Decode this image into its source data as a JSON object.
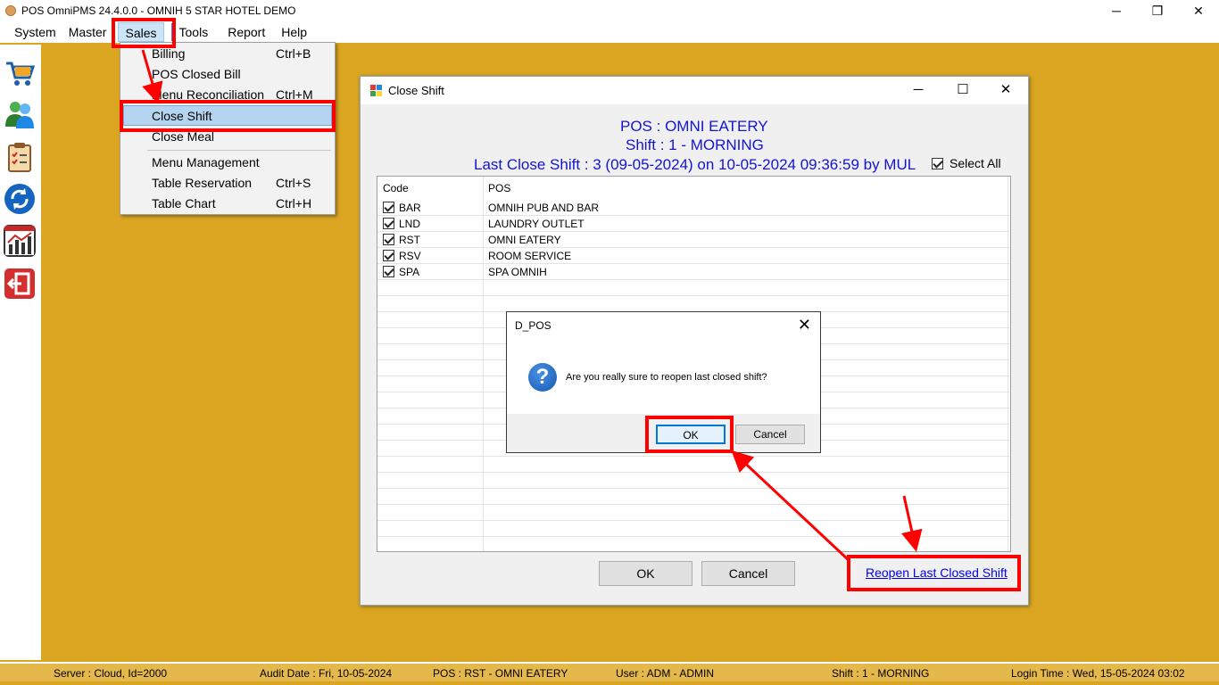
{
  "app": {
    "title": "POS OmniPMS 24.4.0.0 - OMNIH 5 STAR HOTEL DEMO",
    "window_buttons": [
      "─",
      "❐",
      "✕"
    ]
  },
  "menubar": {
    "items": [
      "System",
      "Master",
      "Sales",
      "Tools",
      "Report",
      "Help"
    ]
  },
  "toolbar_icons": [
    "cart-icon",
    "users-icon",
    "clipboard-icon",
    "refresh-icon",
    "chart-icon",
    "exit-icon"
  ],
  "sales_menu": {
    "items": [
      {
        "label": "Billing",
        "shortcut": "Ctrl+B"
      },
      {
        "label": "POS Closed Bill",
        "shortcut": ""
      },
      {
        "label": "Menu Reconciliation",
        "shortcut": "Ctrl+M"
      },
      {
        "label": "Close Shift",
        "shortcut": ""
      },
      {
        "label": "Close Meal",
        "shortcut": ""
      },
      {
        "label": "Menu Management",
        "shortcut": ""
      },
      {
        "label": "Table Reservation",
        "shortcut": "Ctrl+S"
      },
      {
        "label": "Table Chart",
        "shortcut": "Ctrl+H"
      }
    ]
  },
  "close_shift": {
    "title": "Close Shift",
    "pos_line": "POS : OMNI EATERY",
    "shift_line": "Shift : 1 - MORNING",
    "last_close_line": "Last Close Shift : 3 (09-05-2024) on 10-05-2024 09:36:59 by MUL",
    "select_all": "Select All",
    "columns": [
      "Code",
      "POS"
    ],
    "rows": [
      {
        "code": "BAR",
        "pos": "OMNIH PUB AND BAR",
        "checked": true
      },
      {
        "code": "LND",
        "pos": "LAUNDRY OUTLET",
        "checked": true
      },
      {
        "code": "RST",
        "pos": "OMNI EATERY",
        "checked": true
      },
      {
        "code": "RSV",
        "pos": "ROOM SERVICE",
        "checked": true
      },
      {
        "code": "SPA",
        "pos": "SPA OMNIH",
        "checked": true
      }
    ],
    "ok_label": "OK",
    "cancel_label": "Cancel",
    "reopen_link": "Reopen Last Closed Shift"
  },
  "msgbox": {
    "title": "D_POS",
    "message": "Are you really sure to reopen last closed shift?",
    "ok_label": "OK",
    "cancel_label": "Cancel"
  },
  "statusbar": {
    "server": "Server : Cloud, Id=2000",
    "audit_date": "Audit Date : Fri, 10-05-2024",
    "pos": "POS : RST - OMNI EATERY",
    "user": "User : ADM - ADMIN",
    "shift": "Shift : 1 - MORNING",
    "login_time": "Login Time : Wed, 15-05-2024 03:02"
  },
  "colors": {
    "background": "#DAA520",
    "header_text": "#1414D2",
    "annotation": "#FF0000",
    "link": "#0000EE"
  }
}
